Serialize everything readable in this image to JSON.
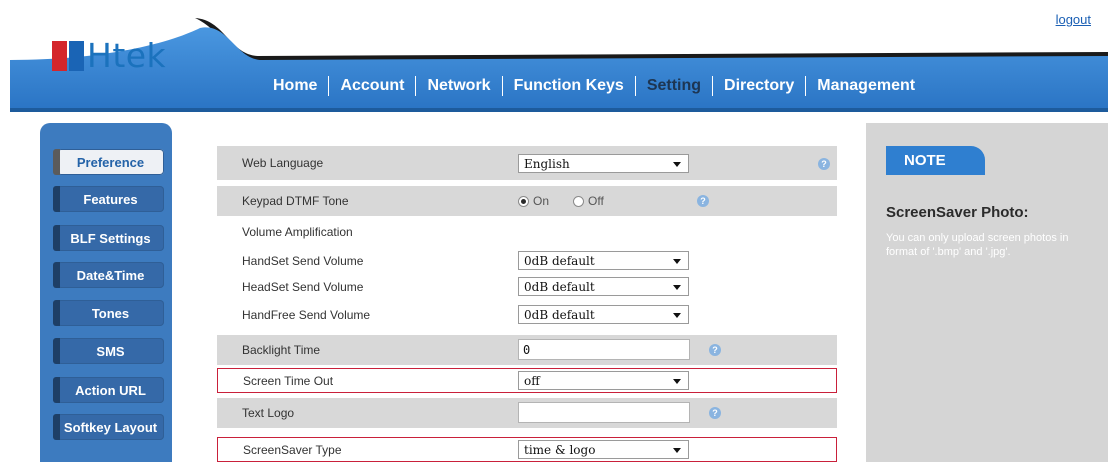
{
  "header": {
    "logo_text": "Htek",
    "logout_label": "logout"
  },
  "nav": {
    "items": [
      {
        "label": "Home"
      },
      {
        "label": "Account"
      },
      {
        "label": "Network"
      },
      {
        "label": "Function Keys"
      },
      {
        "label": "Setting",
        "active": true
      },
      {
        "label": "Directory"
      },
      {
        "label": "Management"
      }
    ]
  },
  "sidebar": {
    "items": [
      {
        "label": "Preference",
        "active": true
      },
      {
        "label": "Features"
      },
      {
        "label": "BLF Settings"
      },
      {
        "label": "Date&Time"
      },
      {
        "label": "Tones"
      },
      {
        "label": "SMS"
      },
      {
        "label": "Action URL"
      },
      {
        "label": "Softkey Layout"
      }
    ]
  },
  "form": {
    "web_language": {
      "label": "Web Language",
      "value": "English"
    },
    "keypad_dtmf_tone": {
      "label": "Keypad DTMF Tone",
      "option_on": "On",
      "option_off": "Off",
      "selected": "On"
    },
    "volume_amplification": {
      "label": "Volume Amplification"
    },
    "handset_send_volume": {
      "label": "HandSet Send Volume",
      "value": "0dB default"
    },
    "headset_send_volume": {
      "label": "HeadSet Send Volume",
      "value": "0dB default"
    },
    "handfree_send_volume": {
      "label": "HandFree Send Volume",
      "value": "0dB default"
    },
    "backlight_time": {
      "label": "Backlight Time",
      "value": "0"
    },
    "screen_time_out": {
      "label": "Screen Time Out",
      "value": "off"
    },
    "text_logo": {
      "label": "Text Logo",
      "value": ""
    },
    "screensaver_type": {
      "label": "ScreenSaver Type",
      "value": "time & logo"
    }
  },
  "note": {
    "tab_label": "NOTE",
    "title": "ScreenSaver Photo:",
    "body": "You can only upload screen photos in format of '.bmp' and '.jpg'."
  },
  "colors": {
    "nav_bar": "#2f7fd0",
    "sidebar": "#3d7bbf",
    "highlight_border": "#c9203a",
    "row_gray": "#d8d8d8"
  }
}
